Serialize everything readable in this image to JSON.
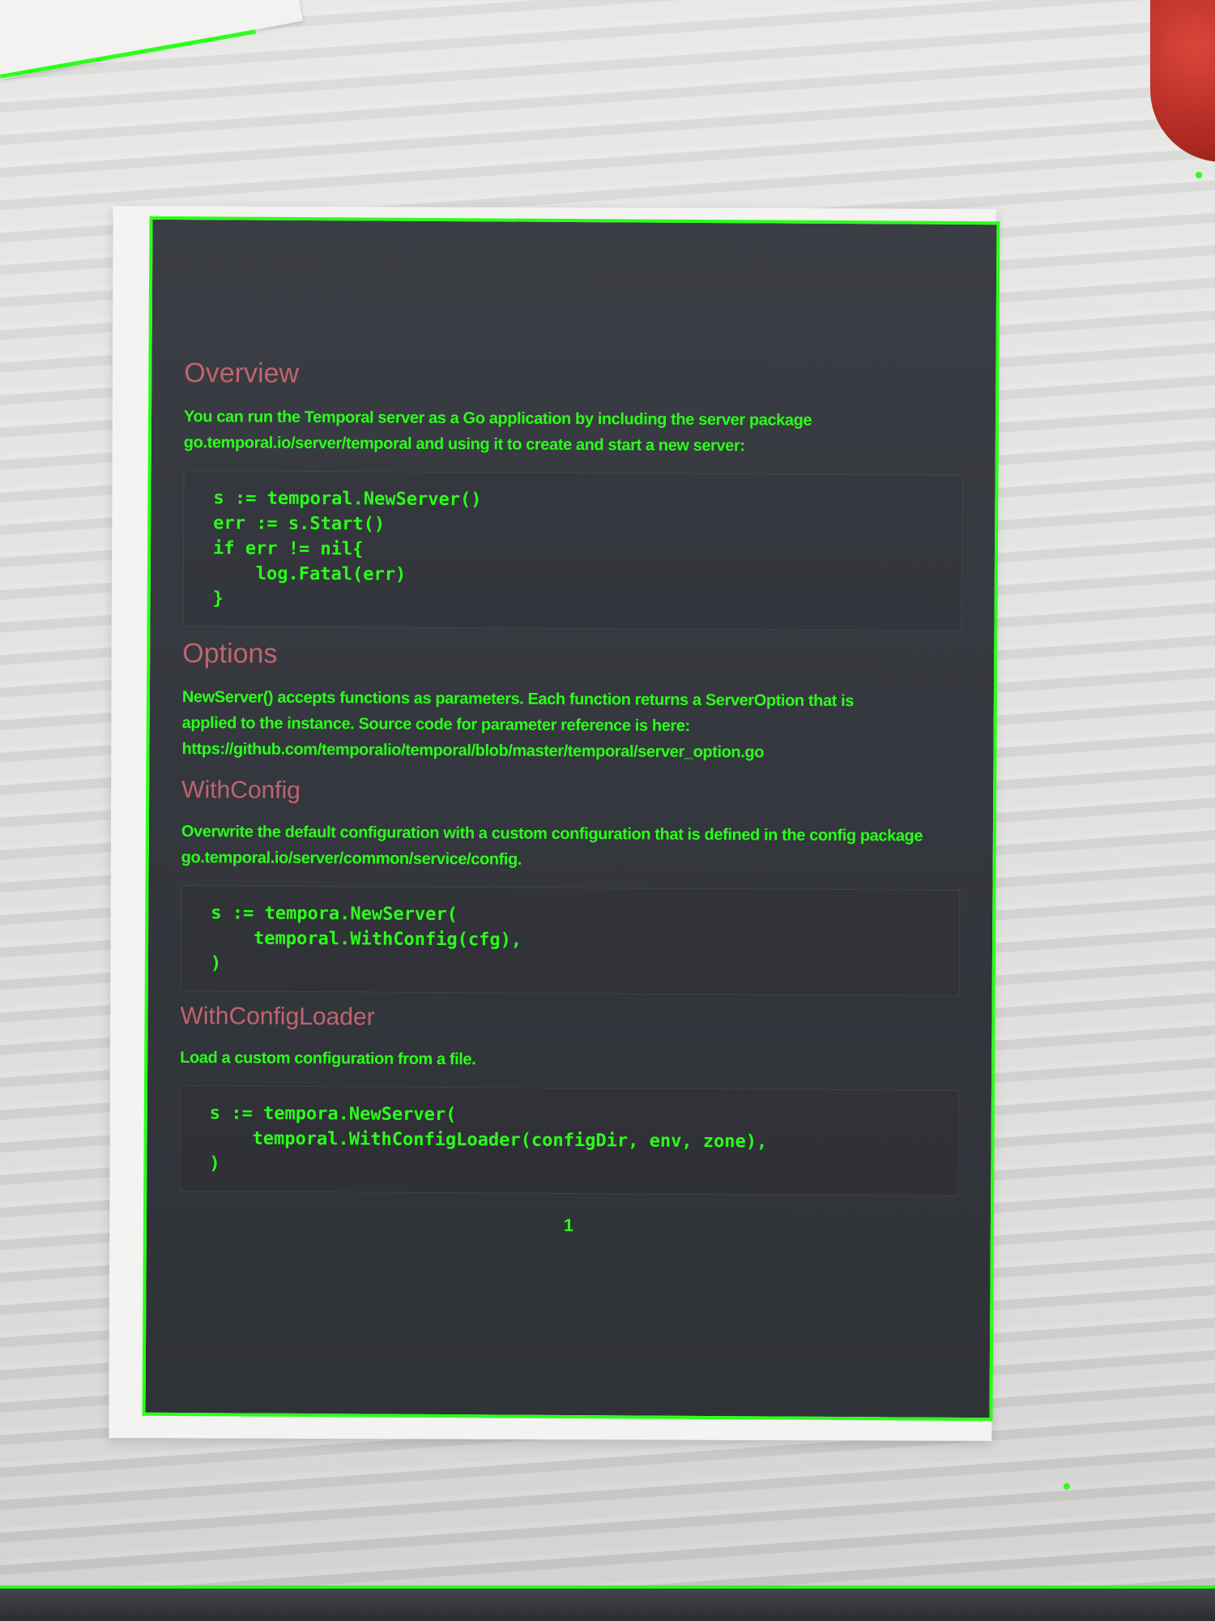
{
  "document": {
    "overview": {
      "heading": "Overview",
      "lines": [
        "You can run the Temporal server as a Go application by including the server package",
        "go.temporal.io/server/temporal and using it to create and start a new server:"
      ],
      "code": [
        "s := temporal.NewServer()",
        "err := s.Start()",
        "if err != nil{",
        "    log.Fatal(err)",
        "}"
      ]
    },
    "options": {
      "heading": "Options",
      "lines": [
        "NewServer() accepts functions as parameters. Each function returns a ServerOption that is",
        "applied to the instance. Source code for parameter reference is here:",
        "https://github.com/temporalio/temporal/blob/master/temporal/server_option.go"
      ]
    },
    "withconfig": {
      "heading": "WithConfig",
      "lines": [
        "Overwrite the default configuration with a custom configuration that is defined in the config package",
        "go.temporal.io/server/common/service/config."
      ],
      "code": [
        "s := tempora.NewServer(",
        "    temporal.WithConfig(cfg),",
        ")"
      ]
    },
    "withconfigloader": {
      "heading": "WithConfigLoader",
      "lines": [
        "Load a custom configuration from a file."
      ],
      "code": [
        "s := tempora.NewServer(",
        "    temporal.WithConfigLoader(configDir, env, zone),",
        ")"
      ]
    },
    "page_number": "1"
  }
}
